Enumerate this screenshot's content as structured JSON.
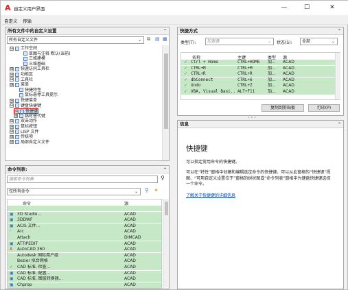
{
  "window": {
    "title": "自定义用户界面",
    "app_logo": "A",
    "minimize": "—",
    "maximize": "☐",
    "close": "✕"
  },
  "menu": {
    "tab1": "自定义",
    "tab2": "传输"
  },
  "customizations": {
    "header": "所有文件中的自定义设置",
    "combo_value": "所有自定义文件",
    "tree": [
      {
        "indent": 0,
        "exp": "⊟",
        "label": "工作空间"
      },
      {
        "indent": 2,
        "exp": "",
        "label": "草图与注释 默认(当前)"
      },
      {
        "indent": 2,
        "exp": "",
        "label": "三维建模"
      },
      {
        "indent": 2,
        "exp": "",
        "label": "三维基础"
      },
      {
        "indent": 0,
        "exp": "⊞",
        "label": "快速访问工具栏"
      },
      {
        "indent": 0,
        "exp": "⊞",
        "label": "功能区"
      },
      {
        "indent": 0,
        "exp": "⊞",
        "label": "工具栏"
      },
      {
        "indent": 0,
        "exp": "⊞",
        "label": "菜单"
      },
      {
        "indent": 1,
        "exp": "",
        "label": "快捷特性"
      },
      {
        "indent": 1,
        "exp": "",
        "label": "鼠标悬停工具提示"
      },
      {
        "indent": 0,
        "exp": "⊞",
        "label": "快捷菜单"
      },
      {
        "indent": 0,
        "exp": "⊟",
        "label": "键盘快捷键"
      },
      {
        "indent": 1,
        "exp": "⊞",
        "label": "快捷键"
      },
      {
        "indent": 1,
        "exp": "⊞",
        "label": "临时替代键"
      },
      {
        "indent": 0,
        "exp": "⊞",
        "label": "双击动作"
      },
      {
        "indent": 0,
        "exp": "⊞",
        "label": "鼠标按钮"
      },
      {
        "indent": 0,
        "exp": "⊞",
        "label": "LISP 文件"
      },
      {
        "indent": 0,
        "exp": "⊞",
        "label": "传统项"
      },
      {
        "indent": 0,
        "exp": "⊞",
        "label": "局部自定义文件"
      }
    ]
  },
  "commands": {
    "header": "命令列表:",
    "search_placeholder": "搜索命令列表",
    "filter_value": "仅所有命令",
    "col_cmd": "命令",
    "col_src": "源",
    "rows": [
      {
        "name": "",
        "src": "",
        "icon": "none"
      },
      {
        "name": "3D Studio...",
        "src": "ACAD",
        "icon": "box"
      },
      {
        "name": "3DDWF",
        "src": "ACAD",
        "icon": "box"
      },
      {
        "name": "ACIS 文件...",
        "src": "ACAD",
        "icon": "box"
      },
      {
        "name": "Arc",
        "src": "ACAD",
        "icon": "arc"
      },
      {
        "name": "Attach",
        "src": "DIMCAD",
        "icon": "none"
      },
      {
        "name": "ATTIPEDIT",
        "src": "ACAD",
        "icon": "box"
      },
      {
        "name": "AutoCAD 360",
        "src": "ACAD",
        "icon": "a"
      },
      {
        "name": "Autodesk 国际用户组",
        "src": "ACAD",
        "icon": "none"
      },
      {
        "name": "Bezier 拟合网格",
        "src": "ACAD",
        "icon": "none"
      },
      {
        "name": "CAD 标准, 检查...",
        "src": "ACAD",
        "icon": "chk"
      },
      {
        "name": "CAD 标准, 配置...",
        "src": "ACAD",
        "icon": "box"
      },
      {
        "name": "CAD 标准, 图层转换器...",
        "src": "ACAD",
        "icon": "box"
      },
      {
        "name": "Chprop",
        "src": "ACAD",
        "icon": "box"
      }
    ]
  },
  "shortcuts": {
    "header": "快捷方式",
    "type_label": "类型(T):",
    "type_value": "加速键",
    "status_label": "状态(S):",
    "status_value": "全部",
    "col_name": "名称",
    "col_key": "主键",
    "col_type": "类型",
    "col_src": "源",
    "rows": [
      {
        "name": "Ctrl + Home",
        "key": "CTRL+HOME",
        "type": "加...",
        "src": "ACAD"
      },
      {
        "name": "CTRL+M",
        "key": "CTRL+M",
        "type": "加...",
        "src": "ACAD"
      },
      {
        "name": "CTRL+R",
        "key": "CTRL+R",
        "type": "加...",
        "src": "ACAD"
      },
      {
        "name": "dbConnect",
        "key": "CTRL+6",
        "type": "加...",
        "src": "ACAD"
      },
      {
        "name": "Undo",
        "key": "CTRL+Z",
        "type": "加...",
        "src": "ACAD"
      },
      {
        "name": "VBA, Visual Basi...",
        "key": "ALT+F11",
        "type": "加...",
        "src": "ACAD"
      }
    ],
    "copy_btn": "复制到剪贴板",
    "print_btn": "打印(P)"
  },
  "info": {
    "header": "信息",
    "title": "快捷键",
    "line1": "可以指定常用命令的快捷键。",
    "para": "可以在“特性”窗格中创建和编辑选定命令的快捷键。可以从此窗格的“快捷键”视图、“可用自定义设置位于”窗格的树状图或“命令列表”窗格中为键盘快捷键选择一个命令。",
    "link": "了解关于快捷键的详细信息"
  }
}
